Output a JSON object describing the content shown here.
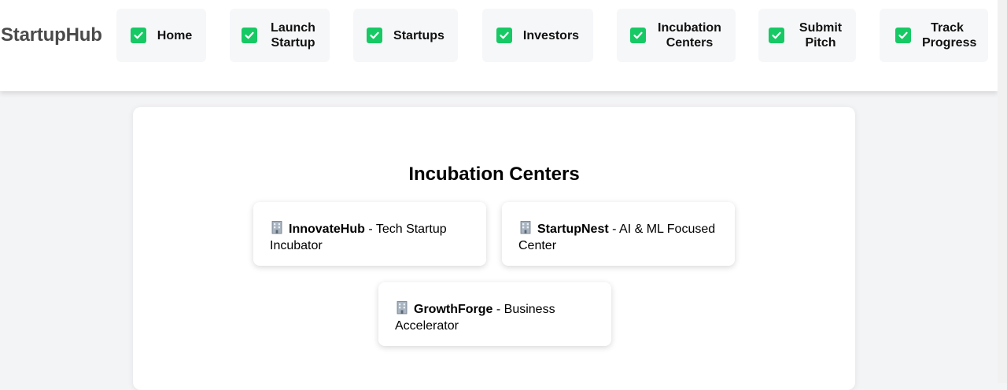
{
  "brand": "StartupHub",
  "colors": {
    "check": "#17c964",
    "nav_bg": "#f6f7f9",
    "page_bg": "#f3f4f6"
  },
  "nav": [
    {
      "label": "Home",
      "icon": "checkbox-checked-icon"
    },
    {
      "label": "Launch Startup",
      "icon": "checkbox-checked-icon"
    },
    {
      "label": "Startups",
      "icon": "checkbox-checked-icon"
    },
    {
      "label": "Investors",
      "icon": "checkbox-checked-icon"
    },
    {
      "label": "Incubation Centers",
      "icon": "checkbox-checked-icon"
    },
    {
      "label": "Submit Pitch",
      "icon": "checkbox-checked-icon"
    },
    {
      "label": "Track Progress",
      "icon": "checkbox-checked-icon"
    }
  ],
  "section": {
    "title": "Incubation Centers",
    "centers": [
      {
        "name": "InnovateHub",
        "desc": " - Tech Startup Incubator",
        "icon": "office-building-icon"
      },
      {
        "name": "StartupNest",
        "desc": " - AI & ML Focused Center",
        "icon": "office-building-icon"
      },
      {
        "name": "GrowthForge",
        "desc": " - Business Accelerator",
        "icon": "office-building-icon"
      }
    ]
  }
}
